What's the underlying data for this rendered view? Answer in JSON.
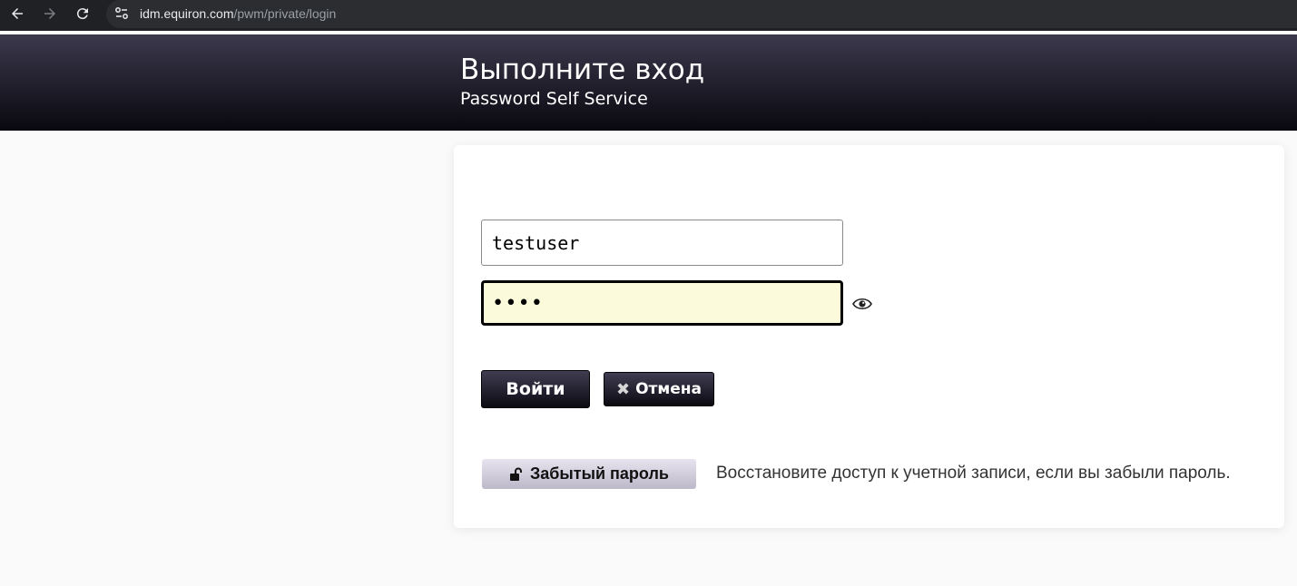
{
  "browser": {
    "url_host": "idm.equiron.com",
    "url_path": "/pwm/private/login"
  },
  "header": {
    "title": "Выполните вход",
    "subtitle": "Password Self Service"
  },
  "form": {
    "username_value": "testuser",
    "password_value": "••••",
    "login_label": "Войти",
    "cancel_label": "Отмена",
    "forgot_label": "Забытый пароль",
    "forgot_description": "Восстановите доступ к учетной записи, если вы забыли пароль."
  },
  "colors": {
    "header_top": "#3c394d",
    "header_bottom": "#09080f",
    "password_bg": "#fbfbdc"
  },
  "icons": [
    "back-arrow-icon",
    "forward-arrow-icon",
    "reload-icon",
    "site-info-icon",
    "eye-icon",
    "close-x-icon",
    "unlock-icon"
  ]
}
